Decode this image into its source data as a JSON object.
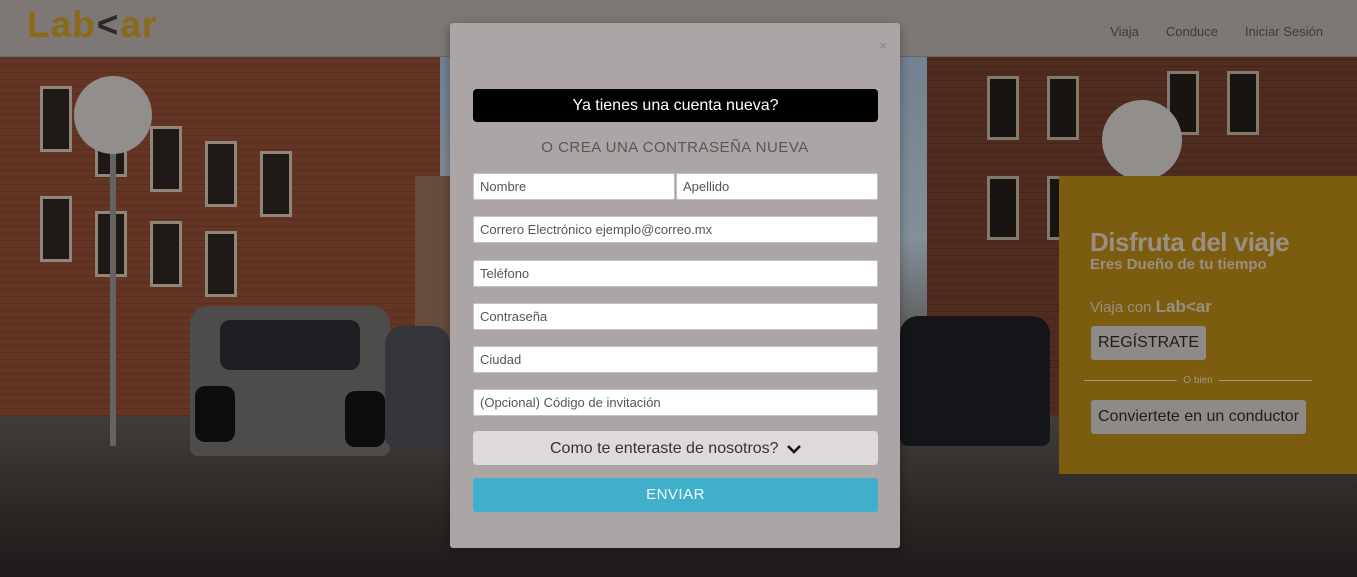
{
  "header": {
    "logo_prefix": "Lab",
    "logo_arrow": "<",
    "logo_suffix": "ar",
    "nav": [
      "Viaja",
      "Conduce",
      "Iniciar Sesión"
    ]
  },
  "modal": {
    "close": "×",
    "banner": "Ya tienes una cuenta nueva?",
    "subtitle": "O CREA UNA CONTRASEÑA NUEVA",
    "fields": {
      "nombre": "Nombre",
      "apellido": "Apellido",
      "correo": "Correro Electrónico ejemplo@correo.mx",
      "telefono": "Teléfono",
      "contrasena": "Contraseña",
      "ciudad": "Ciudad",
      "codigo": "(Opcional) Código de invitación"
    },
    "dropdown_label": "Como te enteraste de nosotros?",
    "dropdown_icon": "chevron-down-icon",
    "submit": "ENVIAR"
  },
  "promo": {
    "title": "Disfruta del viaje",
    "subtitle": "Eres Dueño de tu tiempo",
    "ride_with": "Viaja con",
    "brand": "Lab<ar",
    "register": "REGÍSTRATE",
    "or": "O bien",
    "driver": "Conviertete en un conductor"
  },
  "colors": {
    "brand_gold": "#8a6a16",
    "promo_bg": "#7c5d10",
    "modal_bg": "#aba6a5",
    "submit_blue": "#40afcc"
  }
}
